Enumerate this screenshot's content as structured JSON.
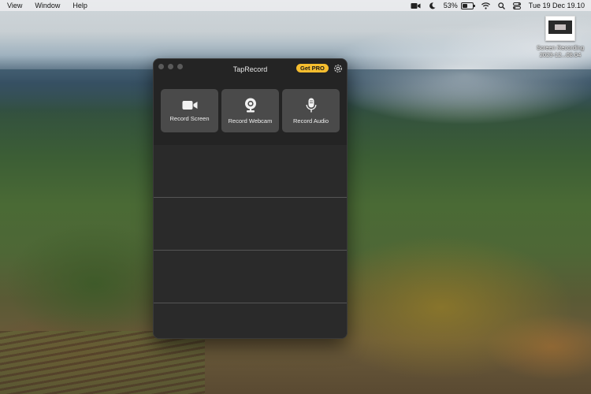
{
  "menubar": {
    "items": [
      "View",
      "Window",
      "Help"
    ],
    "battery_percent": "53%",
    "battery_level": 0.53,
    "datetime": "Tue 19 Dec  19.10",
    "status_icons": [
      "screen-record-icon",
      "moon-icon",
      "wifi-icon",
      "search-icon",
      "control-center-icon"
    ]
  },
  "desktop": {
    "file_name_line1": "Screen Recording",
    "file_name_line2": "2023-12...08.04"
  },
  "app": {
    "title": "TapRecord",
    "get_pro_label": "Get PRO",
    "accent_color": "#f5bd2f",
    "actions": [
      {
        "label": "Record Screen",
        "icon": "video-camera-icon"
      },
      {
        "label": "Record Webcam",
        "icon": "webcam-icon"
      },
      {
        "label": "Record Audio",
        "icon": "microphone-icon"
      }
    ]
  }
}
